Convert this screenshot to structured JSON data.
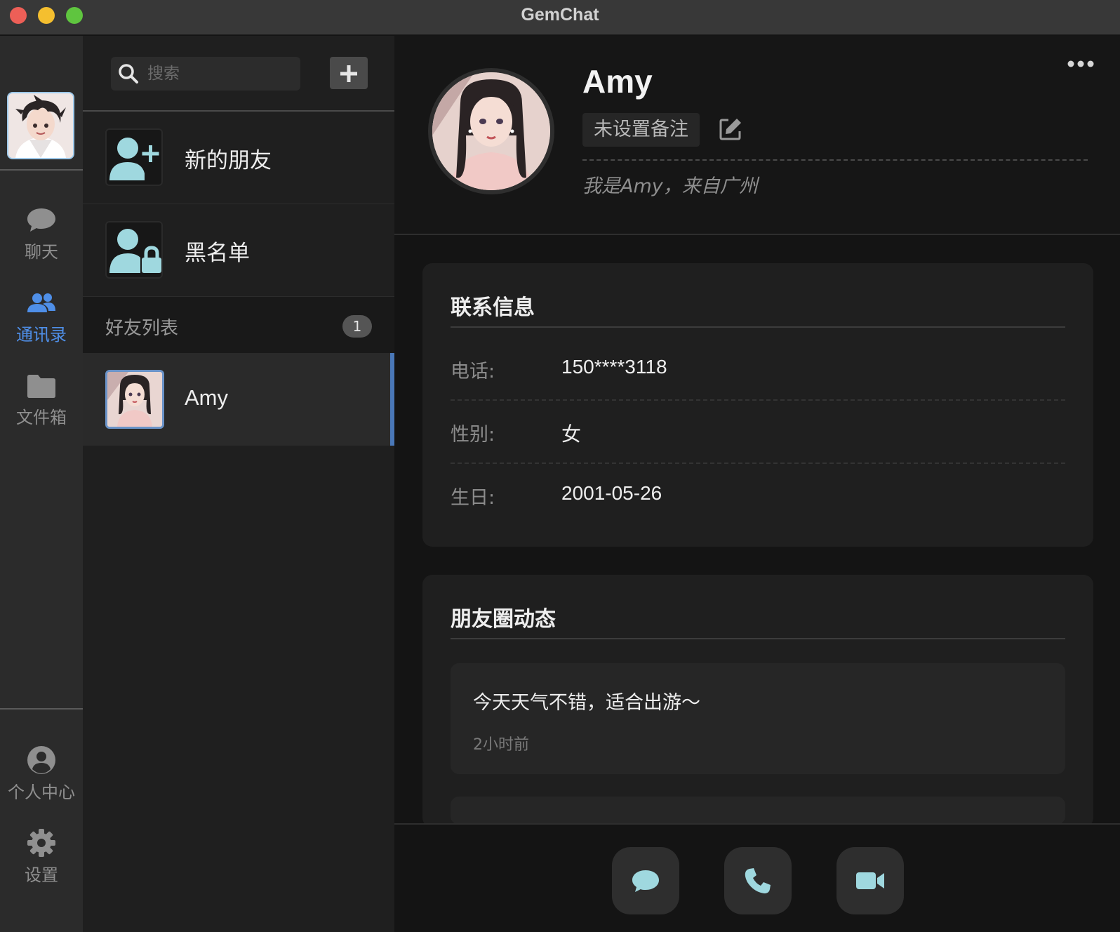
{
  "window": {
    "title": "GemChat"
  },
  "nav": {
    "items": [
      {
        "label": "聊天",
        "icon": "chat-bubble-icon"
      },
      {
        "label": "通讯录",
        "icon": "contacts-icon",
        "active": true
      },
      {
        "label": "文件箱",
        "icon": "folder-icon"
      }
    ],
    "bottom_items": [
      {
        "label": "个人中心",
        "icon": "user-circle-icon"
      },
      {
        "label": "设置",
        "icon": "gear-icon"
      }
    ]
  },
  "contacts": {
    "search": {
      "placeholder": "搜索",
      "value": ""
    },
    "new_friends_label": "新的朋友",
    "blacklist_label": "黑名单",
    "group_title": "好友列表",
    "group_count": "1",
    "friends": [
      {
        "name": "Amy"
      }
    ]
  },
  "profile": {
    "name": "Amy",
    "remark": "未设置备注",
    "signature": "我是Amy，来自广州"
  },
  "contact_info": {
    "title": "联系信息",
    "rows": [
      {
        "label": "电话:",
        "value": "150****3118"
      },
      {
        "label": "性别:",
        "value": "女"
      },
      {
        "label": "生日:",
        "value": "2001-05-26"
      }
    ]
  },
  "moments": {
    "title": "朋友圈动态",
    "posts": [
      {
        "text": "今天天气不错，适合出游～",
        "time": "2小时前"
      }
    ]
  },
  "actions": [
    "message-icon",
    "phone-icon",
    "video-icon"
  ],
  "colors": {
    "accent": "#4f8fe8",
    "icon_tint": "#9fd8df",
    "selection_bar": "#4a78b8",
    "traffic_red": "#ed5f57",
    "traffic_yellow": "#f5bf2f",
    "traffic_green": "#5fc53f"
  }
}
